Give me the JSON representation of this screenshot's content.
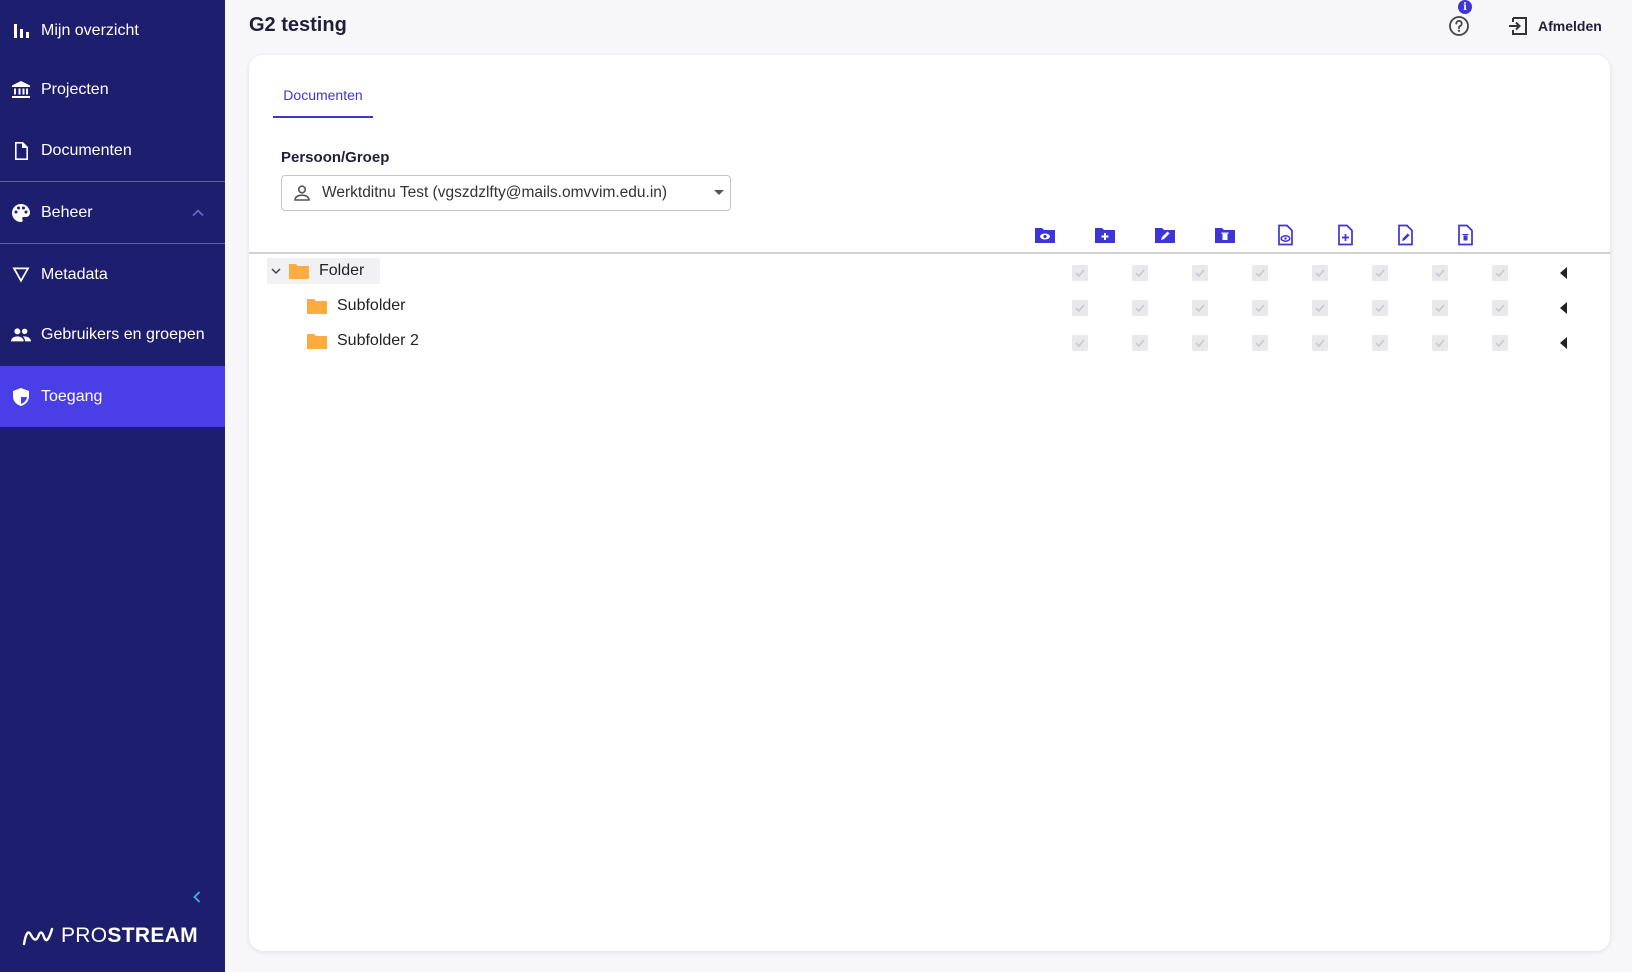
{
  "sidebar": {
    "items": [
      {
        "label": "Mijn overzicht",
        "icon": "bar-chart-icon"
      },
      {
        "label": "Projecten",
        "icon": "bank-icon"
      },
      {
        "label": "Documenten",
        "icon": "document-icon"
      },
      {
        "label": "Beheer",
        "icon": "palette-icon"
      },
      {
        "label": "Metadata",
        "icon": "filter-icon"
      },
      {
        "label": "Gebruikers en groepen",
        "icon": "people-icon"
      },
      {
        "label": "Toegang",
        "icon": "shield-icon"
      }
    ],
    "logo": {
      "prefix": "PRO",
      "suffix": "STREAM"
    }
  },
  "header": {
    "title": "G2 testing",
    "info_badge": "i",
    "logout_label": "Afmelden"
  },
  "main": {
    "tabs": [
      {
        "label": "Documenten"
      }
    ],
    "field_label": "Persoon/Groep",
    "selected_person": "Werktditnu Test (vgszdzlfty@mails.omvvim.edu.in)",
    "permission_icons": [
      "folder-view-icon",
      "folder-add-icon",
      "folder-edit-icon",
      "folder-delete-icon",
      "file-view-icon",
      "file-add-icon",
      "file-edit-icon",
      "file-delete-icon"
    ],
    "rows": [
      {
        "name": "Folder",
        "expanded": true
      },
      {
        "name": "Subfolder"
      },
      {
        "name": "Subfolder 2"
      }
    ]
  },
  "colors": {
    "sidebar_bg": "#1e1e6e",
    "active": "#4a3ee6",
    "accent": "#3d35d6",
    "folder": "#ffab40"
  }
}
